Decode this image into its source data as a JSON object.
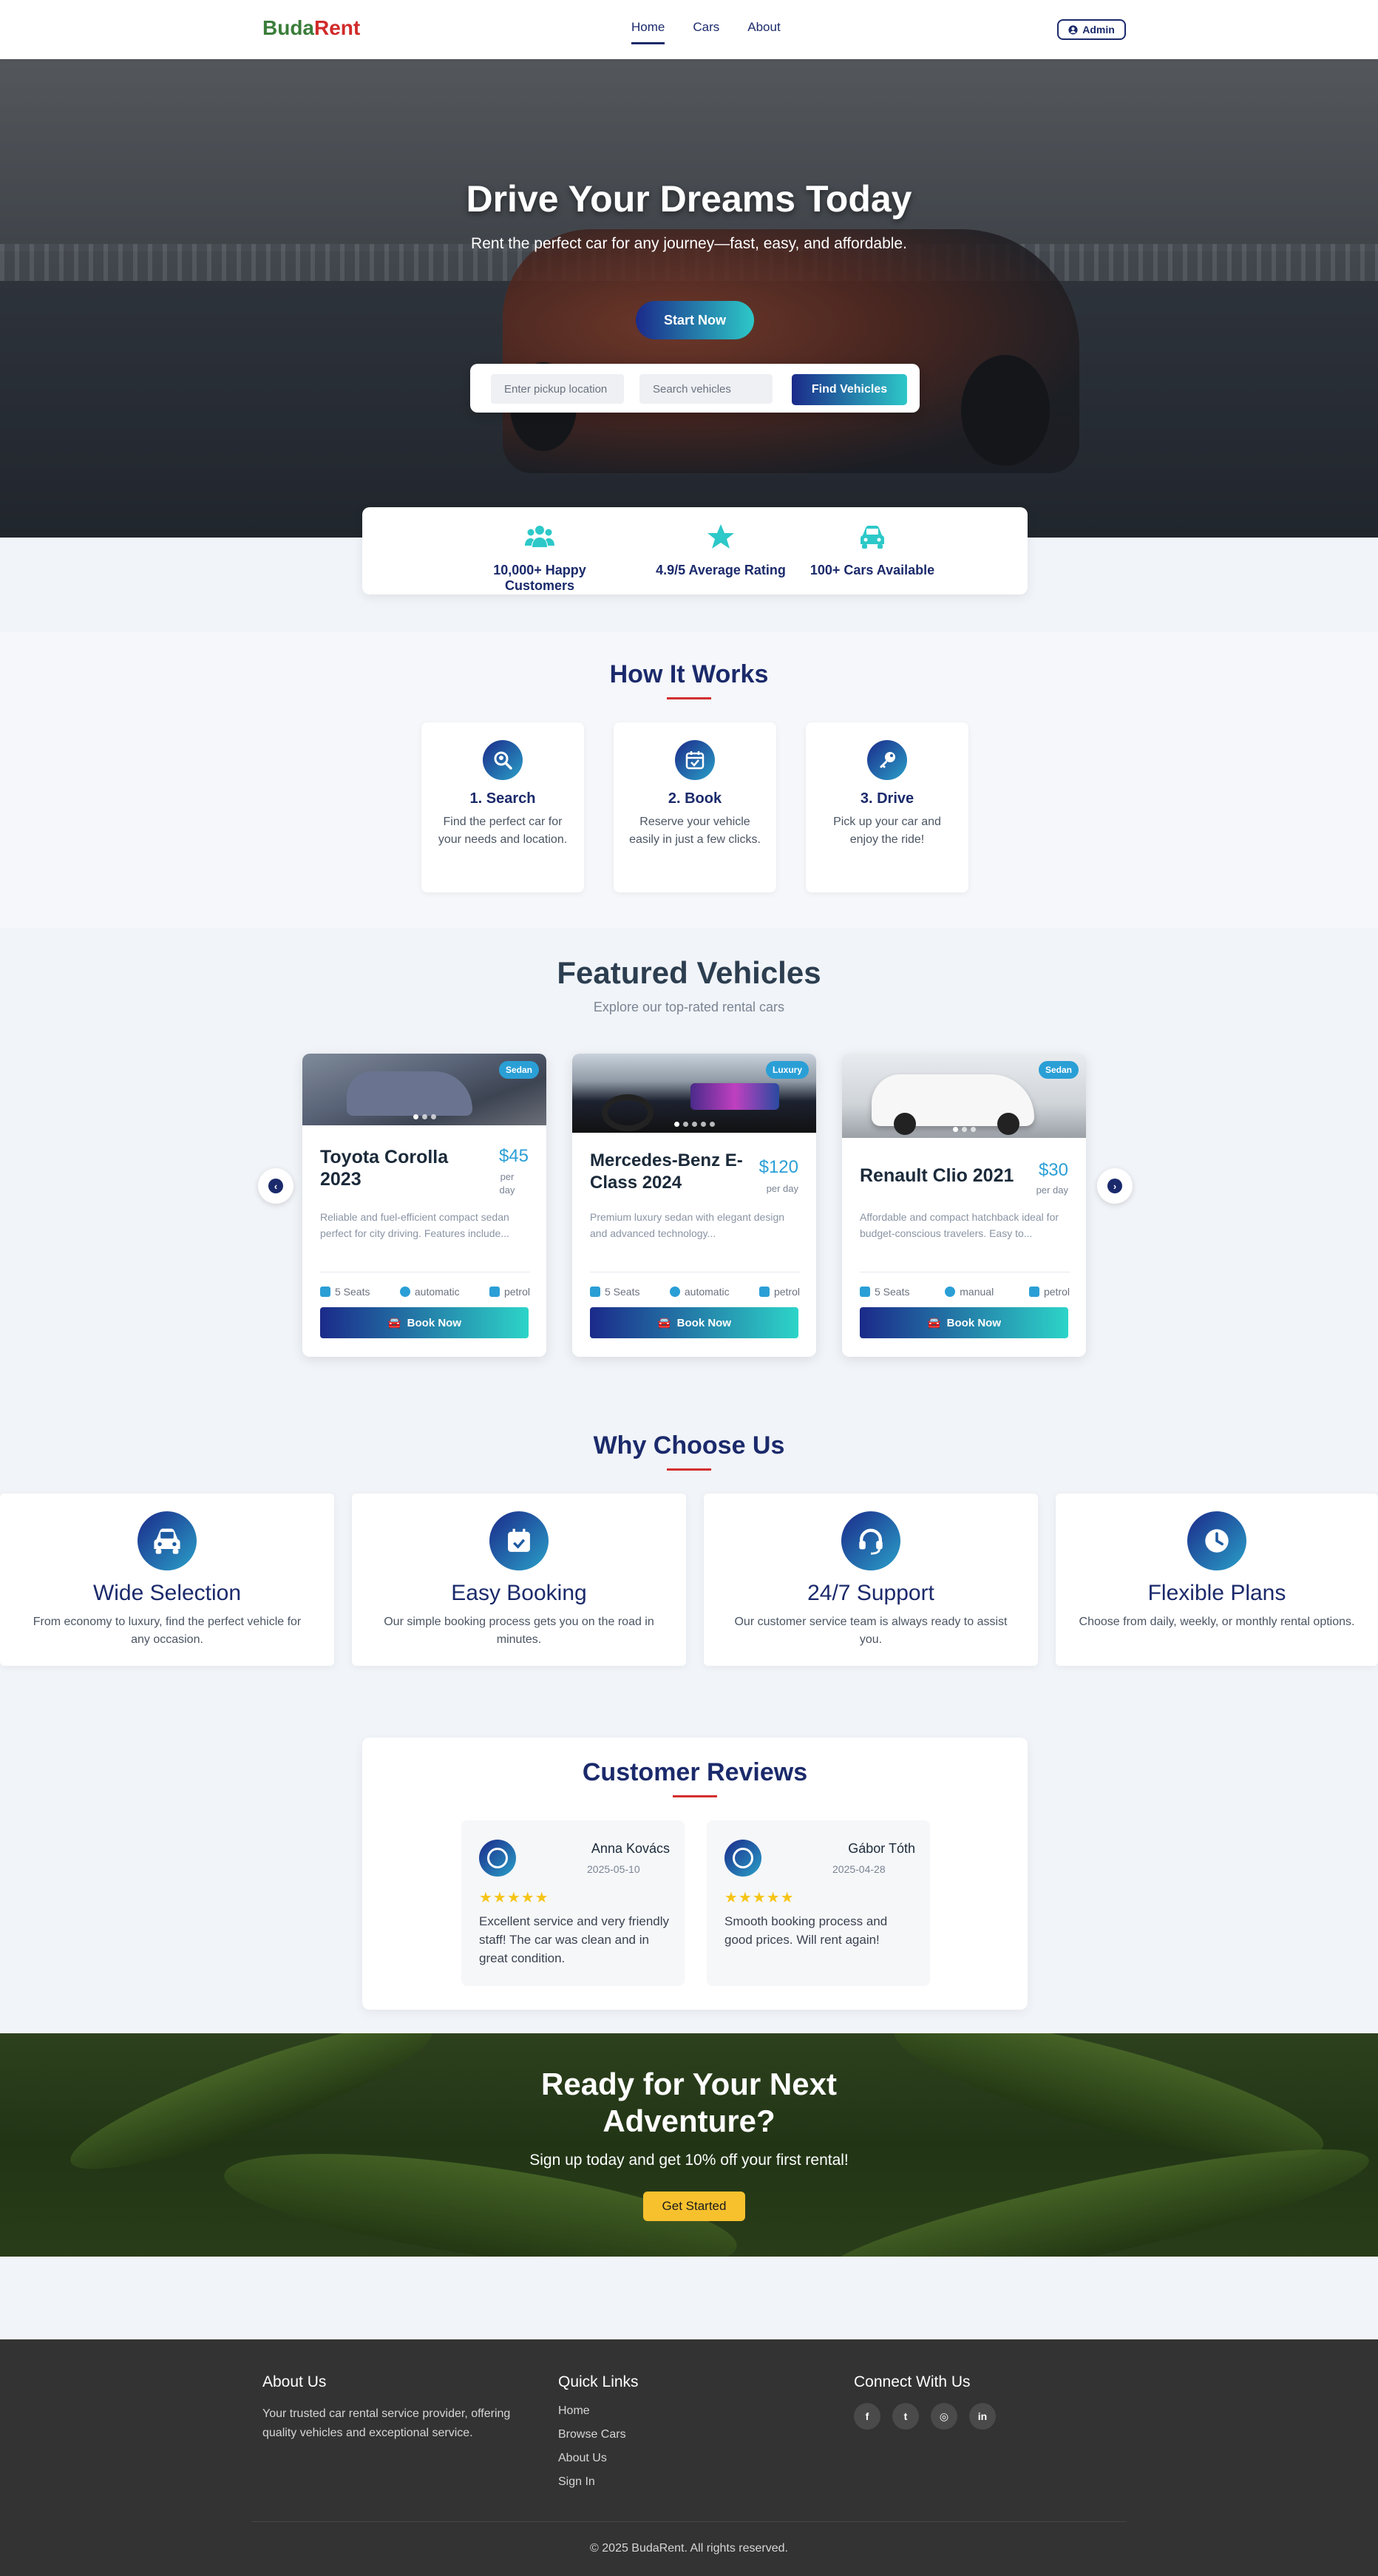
{
  "nav": {
    "logo_part1": "Buda",
    "logo_part2": "Rent",
    "links": [
      "Home",
      "Cars",
      "About"
    ],
    "admin_label": "Admin"
  },
  "hero": {
    "title": "Drive Your Dreams Today",
    "subtitle": "Rent the perfect car for any journey—fast, easy, and affordable.",
    "cta": "Start Now",
    "pickup_placeholder": "Enter pickup location",
    "search_placeholder": "Search vehicles",
    "find_label": "Find Vehicles"
  },
  "stats": [
    {
      "icon": "users-icon",
      "label": "10,000+ Happy Customers"
    },
    {
      "icon": "star-icon",
      "label": "4.9/5 Average Rating"
    },
    {
      "icon": "car-icon",
      "label": "100+ Cars Available"
    }
  ],
  "how": {
    "title": "How It Works",
    "steps": [
      {
        "icon": "search-location-icon",
        "title": "1. Search",
        "text": "Find the perfect car for your needs and location."
      },
      {
        "icon": "calendar-check-icon",
        "title": "2. Book",
        "text": "Reserve your vehicle easily in just a few clicks."
      },
      {
        "icon": "key-icon",
        "title": "3. Drive",
        "text": "Pick up your car and enjoy the ride!"
      }
    ]
  },
  "featured": {
    "title": "Featured Vehicles",
    "subtitle": "Explore our top-rated rental cars",
    "cars": [
      {
        "badge": "Sedan",
        "name": "Toyota Corolla 2023",
        "price": "$45",
        "per": "per day",
        "desc": "Reliable and fuel-efficient compact sedan perfect for city driving. Features include...",
        "seats": "5 Seats",
        "trans": "automatic",
        "fuel": "petrol",
        "book": "Book Now"
      },
      {
        "badge": "Luxury",
        "name": "Mercedes-Benz E-Class 2024",
        "price": "$120",
        "per": "per day",
        "desc": "Premium luxury sedan with elegant design and advanced technology...",
        "seats": "5 Seats",
        "trans": "automatic",
        "fuel": "petrol",
        "book": "Book Now"
      },
      {
        "badge": "Sedan",
        "name": "Renault Clio 2021",
        "price": "$30",
        "per": "per day",
        "desc": "Affordable and compact hatchback ideal for budget-conscious travelers. Easy to...",
        "seats": "5 Seats",
        "trans": "manual",
        "fuel": "petrol",
        "book": "Book Now"
      }
    ]
  },
  "why": {
    "title": "Why Choose Us",
    "items": [
      {
        "icon": "car-icon",
        "title": "Wide Selection",
        "text": "From economy to luxury, find the perfect vehicle for any occasion."
      },
      {
        "icon": "calendar-check-icon",
        "title": "Easy Booking",
        "text": "Our simple booking process gets you on the road in minutes."
      },
      {
        "icon": "headset-icon",
        "title": "24/7 Support",
        "text": "Our customer service team is always ready to assist you."
      },
      {
        "icon": "clock-icon",
        "title": "Flexible Plans",
        "text": "Choose from daily, weekly, or monthly rental options."
      }
    ]
  },
  "reviews": {
    "title": "Customer Reviews",
    "items": [
      {
        "name": "Anna Kovács",
        "date": "2025-05-10",
        "stars": "★★★★★",
        "text": "Excellent service and very friendly staff! The car was clean and in great condition."
      },
      {
        "name": "Gábor Tóth",
        "date": "2025-04-28",
        "stars": "★★★★★",
        "text": "Smooth booking process and good prices. Will rent again!"
      }
    ]
  },
  "cta": {
    "title_line1": "Ready for Your Next",
    "title_line2": "Adventure?",
    "subtitle": "Sign up today and get 10% off your first rental!",
    "button": "Get Started"
  },
  "footer": {
    "about_title": "About Us",
    "about_text_line1": "Your trusted car rental service provider, offering",
    "about_text_line2": "quality vehicles and exceptional service.",
    "links_title": "Quick Links",
    "links": [
      "Home",
      "Browse Cars",
      "About Us",
      "Sign In"
    ],
    "connect_title": "Connect With Us",
    "social": [
      {
        "icon": "facebook-icon",
        "glyph": "f"
      },
      {
        "icon": "twitter-icon",
        "glyph": "t"
      },
      {
        "icon": "instagram-icon",
        "glyph": "◎"
      },
      {
        "icon": "linkedin-icon",
        "glyph": "in"
      }
    ],
    "copyright": "© 2025 BudaRent. All rights reserved."
  },
  "colors": {
    "navy": "#1b2a6b",
    "accent_red": "#d32f2f",
    "teal": "#2dc8c8",
    "blue": "#2a9fd6",
    "cta_yellow": "#f7c12e",
    "footer": "#333333"
  }
}
